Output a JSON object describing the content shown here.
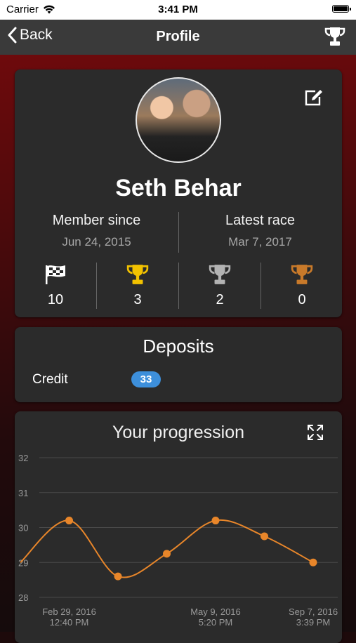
{
  "status_bar": {
    "carrier": "Carrier",
    "time": "3:41 PM"
  },
  "nav": {
    "back_label": "Back",
    "title": "Profile",
    "trophy_icon": "trophy-icon"
  },
  "profile": {
    "name": "Seth Behar",
    "member_since_label": "Member since",
    "member_since_value": "Jun 24, 2015",
    "latest_race_label": "Latest race",
    "latest_race_value": "Mar 7, 2017",
    "stats": [
      {
        "icon": "checkered-flag-icon",
        "value": "10"
      },
      {
        "icon": "gold-trophy-icon",
        "color": "#f2c200",
        "value": "3"
      },
      {
        "icon": "silver-trophy-icon",
        "color": "#b3b3b3",
        "value": "2"
      },
      {
        "icon": "bronze-trophy-icon",
        "color": "#c97a2a",
        "value": "0"
      }
    ]
  },
  "deposits": {
    "title": "Deposits",
    "credit_label": "Credit",
    "credit_value": "33",
    "badge_color": "#3d8fdb"
  },
  "progression": {
    "title": "Your progression"
  },
  "chart_data": {
    "type": "line",
    "title": "Your progression",
    "ylim": [
      28,
      32
    ],
    "y_ticks": [
      "32",
      "31",
      "30",
      "29",
      "28"
    ],
    "x_tick_labels": [
      {
        "date": "Feb 29, 2016",
        "time": "12:40 PM",
        "index": 1
      },
      {
        "date": "May 9, 2016",
        "time": "5:20 PM",
        "index": 4
      },
      {
        "date": "Sep 7, 2016",
        "time": "3:39 PM",
        "index": 6
      }
    ],
    "series": [
      {
        "values": [
          29.0,
          30.2,
          28.6,
          29.25,
          30.2,
          29.75,
          29.0
        ],
        "color": "#e8862a"
      }
    ],
    "grid": true
  }
}
